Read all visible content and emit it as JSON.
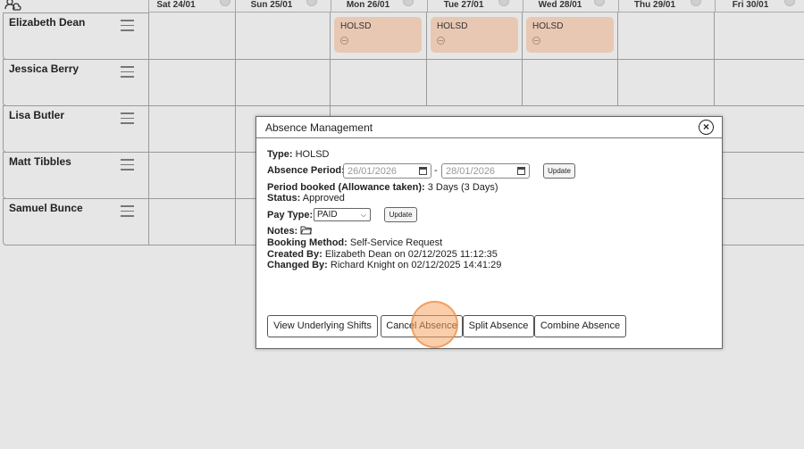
{
  "header": {
    "days": [
      {
        "label": "Sat 24/01"
      },
      {
        "label": "Sun 25/01"
      },
      {
        "label": "Mon 26/01"
      },
      {
        "label": "Tue 27/01"
      },
      {
        "label": "Wed 28/01"
      },
      {
        "label": "Thu 29/01"
      },
      {
        "label": "Fri 30/01"
      }
    ]
  },
  "employees": [
    {
      "name": "Elizabeth Dean",
      "shifts": [
        {
          "day": "Mon 26/01",
          "code": "HOLSD"
        },
        {
          "day": "Tue 27/01",
          "code": "HOLSD"
        },
        {
          "day": "Wed 28/01",
          "code": "HOLSD"
        }
      ]
    },
    {
      "name": "Jessica Berry"
    },
    {
      "name": "Lisa Butler"
    },
    {
      "name": "Matt Tibbles"
    },
    {
      "name": "Samuel Bunce"
    }
  ],
  "modal": {
    "title": "Absence Management",
    "close_icon": "x-circle-icon",
    "type_label": "Type:",
    "type_value": "HOLSD",
    "period_label": "Absence Period:",
    "start_date": "26/01/2026",
    "end_date": "28/01/2026",
    "date_separator": "-",
    "update_label": "Update",
    "booked_label": "Period booked (Allowance taken):",
    "booked_value": "3 Days (3 Days)",
    "status_label": "Status:",
    "status_value": "Approved",
    "pay_type_label": "Pay Type:",
    "pay_type_value": "PAID",
    "notes_label": "Notes:",
    "notes_icon": "folder-icon",
    "booking_method_label": "Booking Method:",
    "booking_method_value": "Self-Service Request",
    "created_by_label": "Created By:",
    "created_by_value": "Elizabeth Dean on 02/12/2025 11:12:35",
    "changed_by_label": "Changed By:",
    "changed_by_value": "Richard Knight on 02/12/2025 14:41:29",
    "buttons": {
      "view_shifts": "View Underlying Shifts",
      "cancel": "Cancel Absence",
      "split": "Split Absence",
      "combine": "Combine Absence"
    }
  },
  "colors": {
    "shift_bg": "#e8c8b3",
    "page_bg": "#e6e6e6",
    "click_marker": "#f5a564"
  }
}
